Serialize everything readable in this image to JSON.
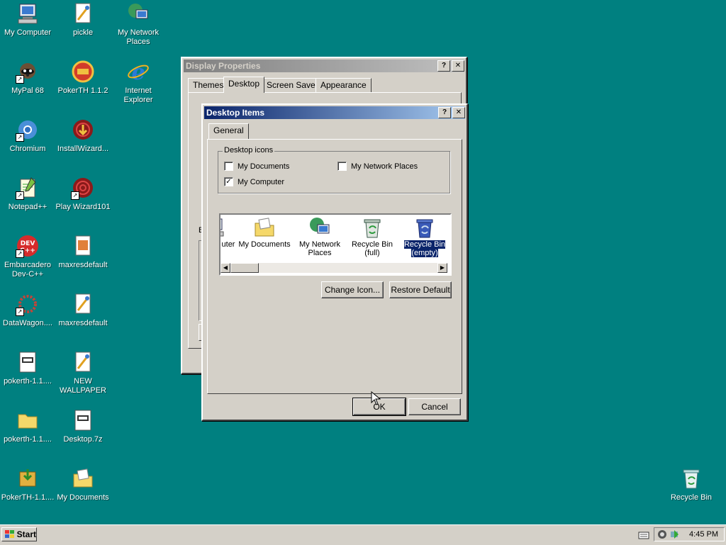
{
  "desktop": {
    "icons": [
      {
        "label": "My Computer",
        "icon": "my-computer-icon"
      },
      {
        "label": "pickle",
        "icon": "image-file-icon"
      },
      {
        "label": "My Network Places",
        "icon": "network-places-icon"
      },
      {
        "label": "MyPal 68",
        "icon": "mypal-icon"
      },
      {
        "label": "PokerTH 1.1.2",
        "icon": "pokerth-icon"
      },
      {
        "label": "Internet Explorer",
        "icon": "internet-explorer-icon"
      },
      {
        "label": "Chromium",
        "icon": "chromium-icon"
      },
      {
        "label": "InstallWizard...",
        "icon": "installwizard-icon"
      },
      {
        "label": "Notepad++",
        "icon": "notepadpp-icon"
      },
      {
        "label": "Play Wizard101",
        "icon": "wizard101-icon"
      },
      {
        "label": "Embarcadero Dev-C++",
        "icon": "devcpp-icon"
      },
      {
        "label": "maxresdefault",
        "icon": "image-file-icon"
      },
      {
        "label": "DataWagon....",
        "icon": "datawagon-icon"
      },
      {
        "label": "maxresdefault",
        "icon": "image-file-icon"
      },
      {
        "label": "pokerth-1.1....",
        "icon": "archive-file-icon"
      },
      {
        "label": "NEW WALLPAPER",
        "icon": "image-file-icon"
      },
      {
        "label": "pokerth-1.1....",
        "icon": "folder-icon"
      },
      {
        "label": "Desktop.7z",
        "icon": "archive-file-icon"
      },
      {
        "label": "PokerTH-1.1....",
        "icon": "installer-icon"
      },
      {
        "label": "My Documents",
        "icon": "my-documents-icon"
      },
      {
        "label": "Recycle Bin",
        "icon": "recycle-bin-icon"
      }
    ]
  },
  "display_properties": {
    "title": "Display Properties",
    "tabs": [
      "Themes",
      "Desktop",
      "Screen Saver",
      "Appearance"
    ],
    "active_tab": "Desktop",
    "partial_label": "B"
  },
  "desktop_items": {
    "title": "Desktop Items",
    "tab": "General",
    "group_label": "Desktop icons",
    "checkboxes": [
      {
        "label": "My Documents",
        "checked": false
      },
      {
        "label": "My Network Places",
        "checked": false
      },
      {
        "label": "My Computer",
        "checked": true
      }
    ],
    "icon_list": [
      {
        "label": "uter",
        "icon": "my-computer-icon"
      },
      {
        "label": "My Documents",
        "icon": "my-documents-icon"
      },
      {
        "label": "My Network Places",
        "icon": "network-places-icon"
      },
      {
        "label": "Recycle Bin (full)",
        "icon": "recycle-bin-full-icon"
      },
      {
        "label": "Recycle Bin (empty)",
        "icon": "recycle-bin-empty-icon",
        "selected": true
      }
    ],
    "change_icon": "Change Icon...",
    "restore_default": "Restore Default",
    "ok": "OK",
    "cancel": "Cancel"
  },
  "taskbar": {
    "start": "Start",
    "clock": "4:45 PM"
  }
}
